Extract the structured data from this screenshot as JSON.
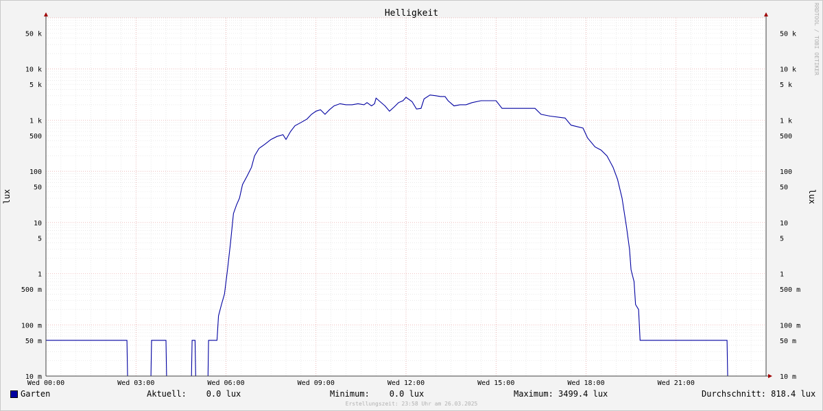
{
  "chart_data": {
    "type": "line",
    "title": "Helligkeit",
    "ylabel": "lux",
    "yscale": "log",
    "ylim": [
      0.01,
      100000
    ],
    "xlim": [
      0,
      24
    ],
    "x_tick_labels": [
      {
        "x": 0,
        "label": "Wed 00:00"
      },
      {
        "x": 3,
        "label": "Wed 03:00"
      },
      {
        "x": 6,
        "label": "Wed 06:00"
      },
      {
        "x": 9,
        "label": "Wed 09:00"
      },
      {
        "x": 12,
        "label": "Wed 12:00"
      },
      {
        "x": 15,
        "label": "Wed 15:00"
      },
      {
        "x": 18,
        "label": "Wed 18:00"
      },
      {
        "x": 21,
        "label": "Wed 21:00"
      }
    ],
    "y_tick_labels": [
      {
        "v": 50000,
        "label": "50 k"
      },
      {
        "v": 10000,
        "label": "10 k"
      },
      {
        "v": 5000,
        "label": "5 k"
      },
      {
        "v": 1000,
        "label": "1 k"
      },
      {
        "v": 500,
        "label": "500"
      },
      {
        "v": 100,
        "label": "100"
      },
      {
        "v": 50,
        "label": "50"
      },
      {
        "v": 10,
        "label": "10"
      },
      {
        "v": 5,
        "label": "5"
      },
      {
        "v": 1,
        "label": "1"
      },
      {
        "v": 0.5,
        "label": "500 m"
      },
      {
        "v": 0.1,
        "label": "100 m"
      },
      {
        "v": 0.05,
        "label": "50 m"
      },
      {
        "v": 0.01,
        "label": "10 m"
      }
    ],
    "grid": true,
    "series": [
      {
        "name": "Garten",
        "color": "#0000a0",
        "points": [
          [
            0,
            0.05
          ],
          [
            2.7,
            0.05
          ],
          [
            2.72,
            0.01
          ],
          [
            3.5,
            0.01
          ],
          [
            3.52,
            0.05
          ],
          [
            4.0,
            0.05
          ],
          [
            4.02,
            0.01
          ],
          [
            4.85,
            0.01
          ],
          [
            4.87,
            0.05
          ],
          [
            4.97,
            0.05
          ],
          [
            4.99,
            0.01
          ],
          [
            5.4,
            0.01
          ],
          [
            5.42,
            0.05
          ],
          [
            5.7,
            0.05
          ],
          [
            5.75,
            0.15
          ],
          [
            5.85,
            0.25
          ],
          [
            5.95,
            0.4
          ],
          [
            6.05,
            1.2
          ],
          [
            6.15,
            4
          ],
          [
            6.25,
            15
          ],
          [
            6.35,
            22
          ],
          [
            6.45,
            30
          ],
          [
            6.55,
            55
          ],
          [
            6.7,
            80
          ],
          [
            6.85,
            120
          ],
          [
            6.95,
            200
          ],
          [
            7.1,
            280
          ],
          [
            7.3,
            340
          ],
          [
            7.5,
            420
          ],
          [
            7.7,
            480
          ],
          [
            7.9,
            520
          ],
          [
            8.0,
            420
          ],
          [
            8.15,
            600
          ],
          [
            8.3,
            780
          ],
          [
            8.5,
            900
          ],
          [
            8.7,
            1050
          ],
          [
            8.85,
            1300
          ],
          [
            9.0,
            1500
          ],
          [
            9.15,
            1600
          ],
          [
            9.3,
            1300
          ],
          [
            9.45,
            1600
          ],
          [
            9.6,
            1900
          ],
          [
            9.8,
            2100
          ],
          [
            10.0,
            2000
          ],
          [
            10.2,
            2000
          ],
          [
            10.4,
            2100
          ],
          [
            10.6,
            2000
          ],
          [
            10.7,
            2200
          ],
          [
            10.85,
            1900
          ],
          [
            10.95,
            2100
          ],
          [
            11.0,
            2700
          ],
          [
            11.1,
            2400
          ],
          [
            11.3,
            1900
          ],
          [
            11.45,
            1500
          ],
          [
            11.6,
            1800
          ],
          [
            11.75,
            2200
          ],
          [
            11.9,
            2400
          ],
          [
            12.0,
            2800
          ],
          [
            12.2,
            2300
          ],
          [
            12.35,
            1650
          ],
          [
            12.5,
            1700
          ],
          [
            12.6,
            2600
          ],
          [
            12.8,
            3100
          ],
          [
            13.0,
            3000
          ],
          [
            13.15,
            2900
          ],
          [
            13.3,
            2900
          ],
          [
            13.4,
            2400
          ],
          [
            13.6,
            1900
          ],
          [
            13.8,
            2000
          ],
          [
            14.0,
            2000
          ],
          [
            14.2,
            2200
          ],
          [
            14.5,
            2400
          ],
          [
            14.8,
            2400
          ],
          [
            15.0,
            2400
          ],
          [
            15.2,
            1700
          ],
          [
            15.5,
            1700
          ],
          [
            16.0,
            1700
          ],
          [
            16.3,
            1700
          ],
          [
            16.5,
            1300
          ],
          [
            16.8,
            1200
          ],
          [
            17.3,
            1100
          ],
          [
            17.5,
            800
          ],
          [
            17.9,
            700
          ],
          [
            18.05,
            450
          ],
          [
            18.3,
            300
          ],
          [
            18.5,
            260
          ],
          [
            18.7,
            200
          ],
          [
            18.9,
            120
          ],
          [
            19.05,
            70
          ],
          [
            19.2,
            30
          ],
          [
            19.35,
            8
          ],
          [
            19.45,
            3
          ],
          [
            19.5,
            1.2
          ],
          [
            19.6,
            0.7
          ],
          [
            19.65,
            0.25
          ],
          [
            19.75,
            0.2
          ],
          [
            19.8,
            0.05
          ],
          [
            22.7,
            0.05
          ],
          [
            22.72,
            0.01
          ],
          [
            24,
            0.01
          ]
        ]
      }
    ]
  },
  "legend": {
    "series_name": "Garten",
    "aktuell": "Aktuell:    0.0 lux",
    "minimum": "Minimum:    0.0 lux",
    "maximum": "Maximum: 3499.4 lux",
    "durchschnitt": "Durchschnitt: 818.4 lux"
  },
  "footer": "Erstellungszeit: 23:58 Uhr am 26.03.2025",
  "watermark": "RRDTOOL / TOBI OETIKER"
}
